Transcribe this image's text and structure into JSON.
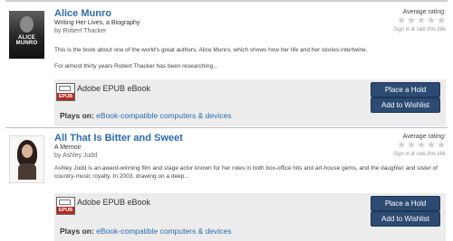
{
  "entries": [
    {
      "title": "Alice Munro",
      "subtitle": "Writing Her Lives, a Biography",
      "author": "by Robert Thacker",
      "cover_text": "ALICE MUNRO",
      "rating_label": "Average rating:",
      "stars": 5,
      "rating_value": 0,
      "signin": "Sign in & rate this title",
      "description": [
        "This is the book about one of the world's great authors. Alice Munro, which shows how her life and her stories intertwine.",
        "For almost thirty years Robert Thacker has been researching..."
      ],
      "format": "Adobe EPUB eBook",
      "format_badge": "EPUB",
      "plays_label": "Plays on:",
      "plays_link": "eBook-compatible computers & devices",
      "hold_button": "Place a Hold",
      "wishlist_button": "Add to Wishlist"
    },
    {
      "title": "All That Is Bitter and Sweet",
      "subtitle": "A Memoir",
      "author": "by Ashley Judd",
      "rating_label": "Average rating:",
      "stars": 5,
      "rating_value": 0,
      "signin": "Sign in & rate this title",
      "description": [
        "Ashley Judd is an award-winning film and stage actor known for her roles in both box-office hits and art-house gems, and the daughter and sister of country-music royalty. In 2003, drawing on a deep..."
      ],
      "format": "Adobe EPUB eBook",
      "format_badge": "EPUB",
      "plays_label": "Plays on:",
      "plays_link": "eBook-compatible computers & devices",
      "hold_button": "Place a Hold",
      "wishlist_button": "Add to Wishlist"
    }
  ],
  "colors": {
    "link": "#2a6bb0",
    "button": "#2c4a72",
    "format_bar": "#ececec",
    "epub_badge": "#b22a1f",
    "star_empty": "#cfcfcf"
  }
}
